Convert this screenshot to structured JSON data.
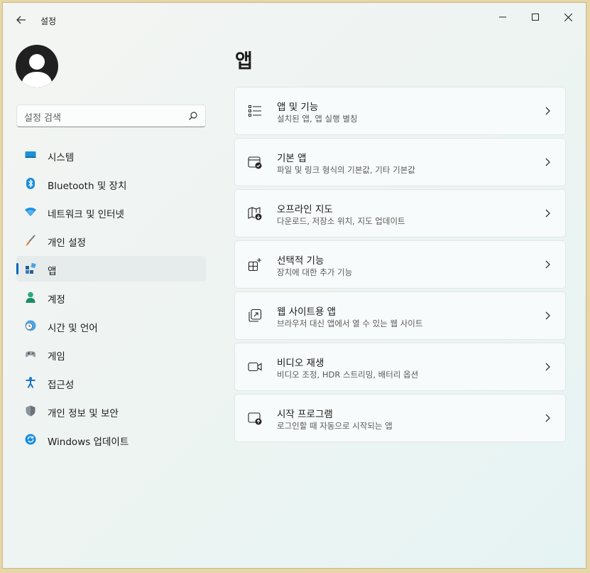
{
  "window": {
    "title": "설정"
  },
  "search": {
    "placeholder": "설정 검색"
  },
  "sidebar": {
    "items": [
      {
        "label": "시스템",
        "icon": "display-icon",
        "active": false
      },
      {
        "label": "Bluetooth 및 장치",
        "icon": "bluetooth-icon",
        "active": false
      },
      {
        "label": "네트워크 및 인터넷",
        "icon": "wifi-icon",
        "active": false
      },
      {
        "label": "개인 설정",
        "icon": "brush-icon",
        "active": false
      },
      {
        "label": "앱",
        "icon": "apps-icon",
        "active": true
      },
      {
        "label": "계정",
        "icon": "person-icon",
        "active": false
      },
      {
        "label": "시간 및 언어",
        "icon": "globe-clock-icon",
        "active": false
      },
      {
        "label": "게임",
        "icon": "gamepad-icon",
        "active": false
      },
      {
        "label": "접근성",
        "icon": "accessibility-icon",
        "active": false
      },
      {
        "label": "개인 정보 및 보안",
        "icon": "shield-icon",
        "active": false
      },
      {
        "label": "Windows 업데이트",
        "icon": "update-icon",
        "active": false
      }
    ]
  },
  "main": {
    "title": "앱",
    "cards": [
      {
        "title": "앱 및 기능",
        "desc": "설치된 앱, 앱 실행 별칭",
        "icon": "apps-list-icon"
      },
      {
        "title": "기본 앱",
        "desc": "파일 및 링크 형식의 기본값, 기타 기본값",
        "icon": "default-apps-icon"
      },
      {
        "title": "오프라인 지도",
        "desc": "다운로드, 저장소 위치, 지도 업데이트",
        "icon": "offline-map-icon"
      },
      {
        "title": "선택적 기능",
        "desc": "장치에 대한 추가 기능",
        "icon": "optional-features-icon"
      },
      {
        "title": "웹 사이트용 앱",
        "desc": "브라우저 대신 앱에서 열 수 있는 웹 사이트",
        "icon": "websites-icon"
      },
      {
        "title": "비디오 재생",
        "desc": "비디오 조정, HDR 스트리밍, 배터리 옵션",
        "icon": "video-icon"
      },
      {
        "title": "시작 프로그램",
        "desc": "로그인할 때 자동으로 시작되는 앱",
        "icon": "startup-icon"
      }
    ]
  },
  "colors": {
    "accent": "#0067c0",
    "background": "#eef4f2",
    "card": "#f8fbfb"
  }
}
